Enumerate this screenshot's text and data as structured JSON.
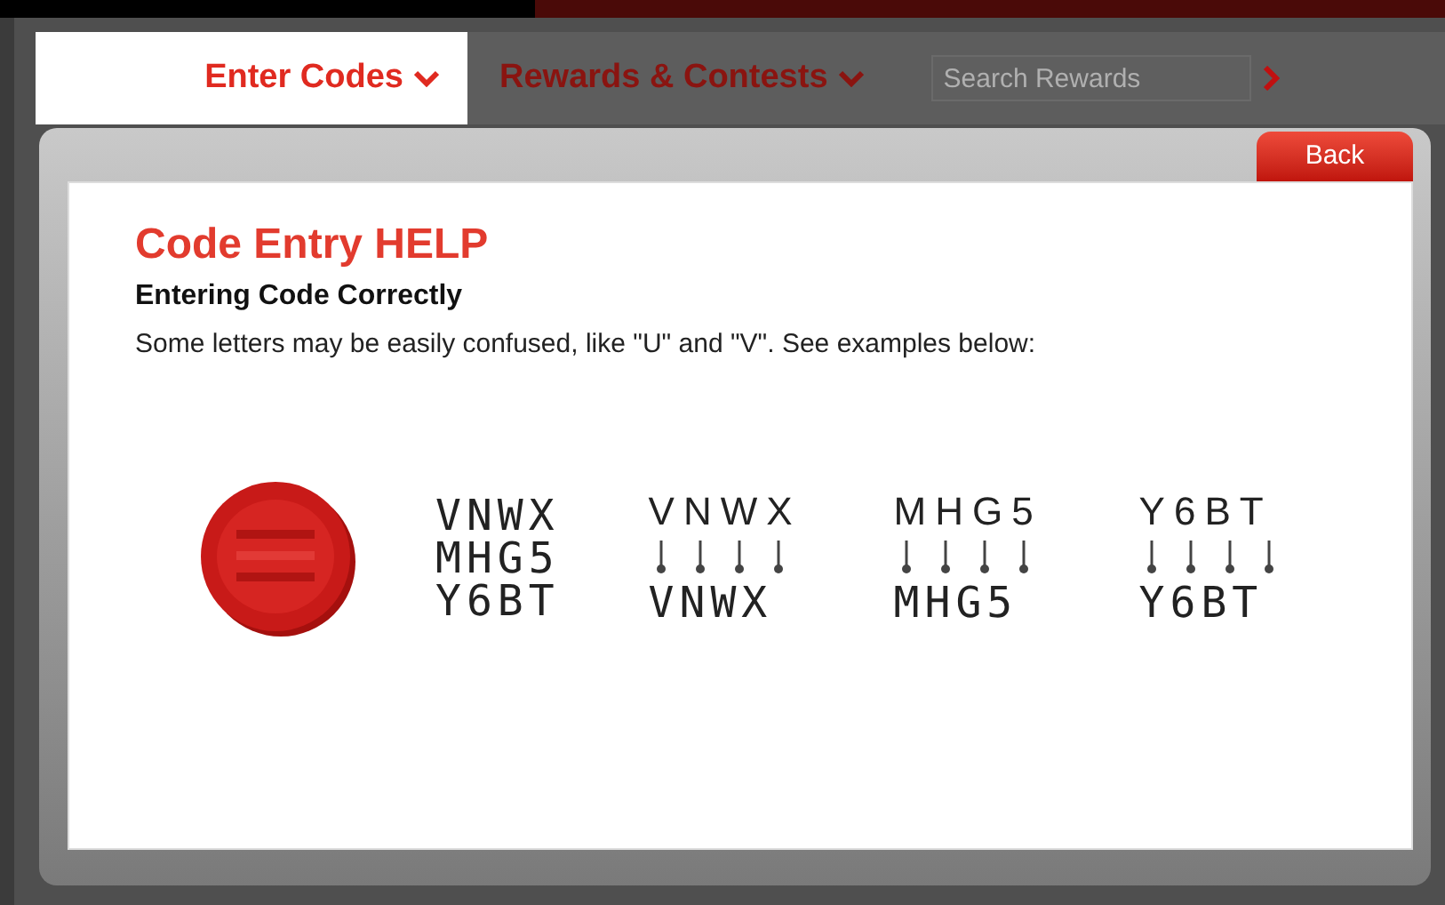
{
  "nav": {
    "tabs": [
      {
        "label": "Enter Codes",
        "selected": true
      },
      {
        "label": "Rewards & Contests",
        "selected": false
      }
    ],
    "search": {
      "placeholder": "Search Rewards"
    }
  },
  "dialog": {
    "back_button": "Back",
    "title": "Code Entry HELP",
    "subtitle": "Entering Code Correctly",
    "text": "Some letters may be easily confused, like \"U\" and \"V\". See examples below:",
    "code_lines": [
      "VNWX",
      "MHG5",
      "Y6BT"
    ],
    "examples": [
      {
        "printed": "VNWX",
        "entered": "VNWX"
      },
      {
        "printed": "MHG5",
        "entered": "MHG5"
      },
      {
        "printed": "Y6BT",
        "entered": "Y6BT"
      }
    ]
  }
}
